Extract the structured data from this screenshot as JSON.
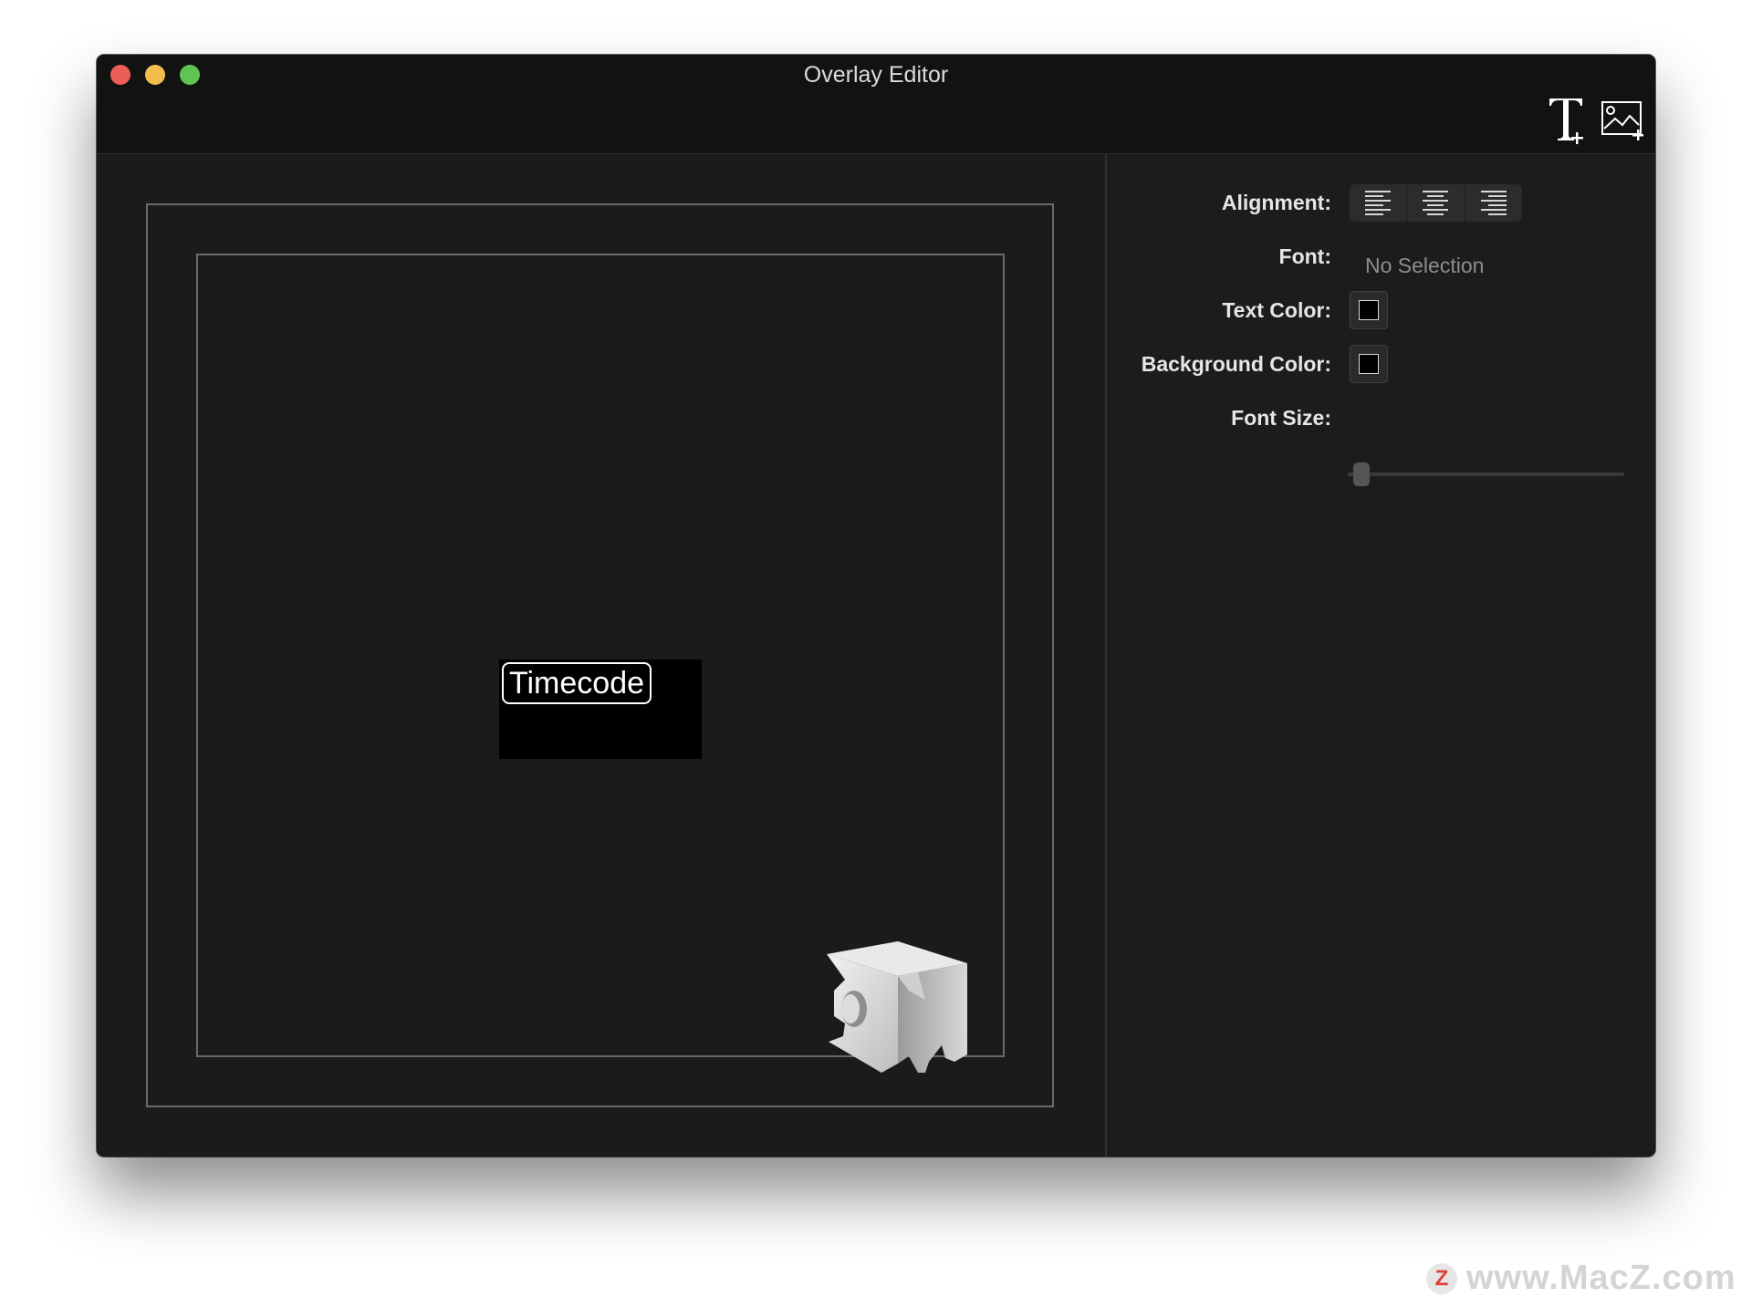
{
  "window": {
    "title": "Overlay Editor",
    "toolbar": {
      "add_text_icon": "text-add-icon",
      "add_image_icon": "image-add-icon"
    }
  },
  "canvas": {
    "overlays": [
      {
        "type": "text",
        "label": "Timecode",
        "background": "#000000",
        "text_color": "#ffffff"
      },
      {
        "type": "image",
        "icon": "3d-m-logo"
      }
    ]
  },
  "inspector": {
    "alignment": {
      "label": "Alignment:",
      "options": [
        "align-left",
        "align-center",
        "align-right"
      ]
    },
    "font": {
      "label": "Font:",
      "value": "No Selection"
    },
    "text_color": {
      "label": "Text  Color:",
      "value": "#000000"
    },
    "background_color": {
      "label": "Background Color:",
      "value": "#000000"
    },
    "font_size": {
      "label": "Font Size:",
      "value": 0
    }
  },
  "watermark": {
    "icon": "Z",
    "text": "www.MacZ.com"
  },
  "colors": {
    "close": "#ec5f56",
    "minimize": "#f4be4f",
    "maximize": "#60c454",
    "window_bg": "#1c1c1c",
    "titlebar_bg": "#121212"
  }
}
